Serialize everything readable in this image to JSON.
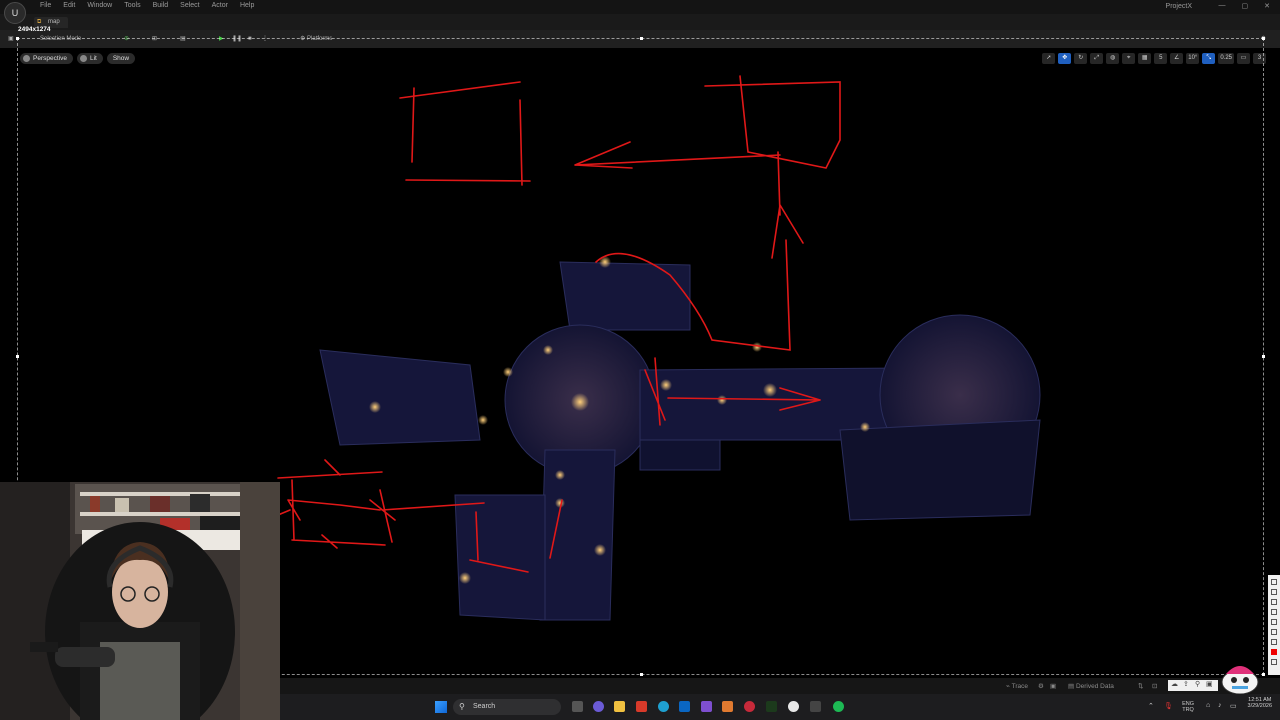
{
  "titlebar": {
    "menu": [
      "File",
      "Edit",
      "Window",
      "Tools",
      "Build",
      "Select",
      "Actor",
      "Help"
    ],
    "project_name": "ProjectX"
  },
  "tab": {
    "label": "map"
  },
  "dimensions_label": "2494x1274",
  "toolbar": {
    "mode_label": "Selection Mode",
    "platforms_label": "Platforms"
  },
  "viewport": {
    "perspective_label": "Perspective",
    "lit_label": "Lit",
    "show_label": "Show",
    "grid_snap": "5",
    "rotation_snap": "10°",
    "scale_snap": "0.25",
    "camera_speed": "3"
  },
  "statusbar": {
    "trace_label": "Trace",
    "derived_data_label": "Derived Data"
  },
  "taskbar": {
    "search_placeholder": "Search",
    "lang_line1": "ENG",
    "lang_line2": "TRQ",
    "time": "12:51 AM",
    "date": "3/29/2026"
  },
  "icons": {
    "palette": [
      "pointer-icon",
      "pen-icon",
      "line-icon",
      "arrow-icon",
      "rect-icon",
      "marker-icon",
      "text-icon",
      "color-red-swatch",
      "undo-icon"
    ]
  },
  "colors": {
    "annotation": "#e01818",
    "accent": "#1f5fbf"
  }
}
